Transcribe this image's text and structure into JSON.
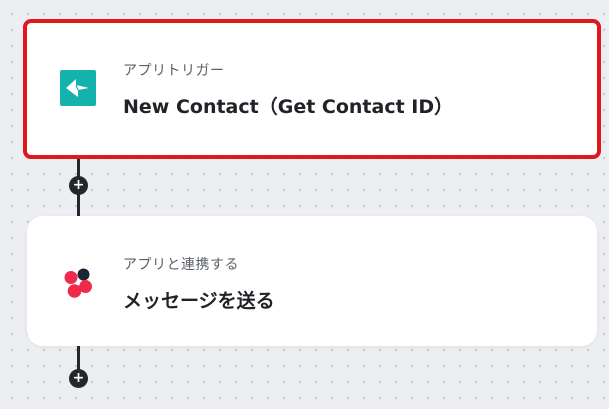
{
  "flow": {
    "steps": [
      {
        "subtitle": "アプリトリガー",
        "title": "New Contact（Get Contact ID）",
        "icon": "teal-app-icon",
        "icon_color": "#14b2ad",
        "highlighted": true
      },
      {
        "subtitle": "アプリと連携する",
        "title": "メッセージを送る",
        "icon": "pinwheel-app-icon",
        "icon_colors": [
          "#ee2b4b",
          "#1d2535"
        ],
        "highlighted": false
      }
    ],
    "add_step_symbol": "+"
  },
  "colors": {
    "highlight": "#e0171b",
    "connector": "#23262b",
    "canvas": "#eceef1"
  }
}
